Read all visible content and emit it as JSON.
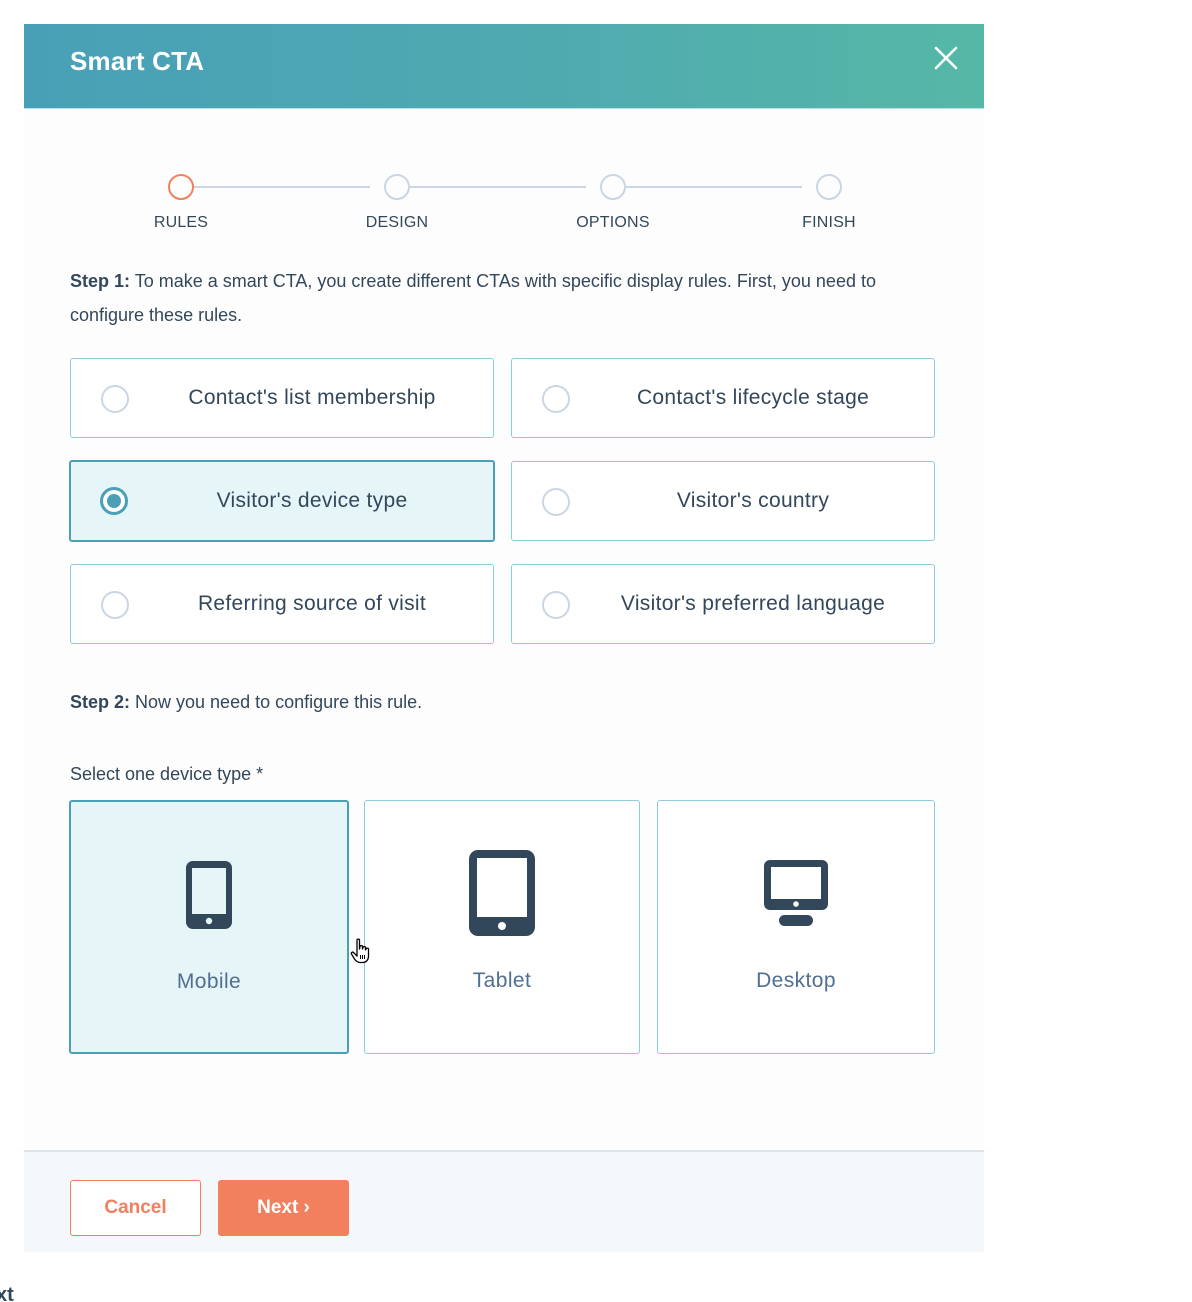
{
  "modal": {
    "title": "Smart CTA",
    "close_icon": "close-icon"
  },
  "stepper": {
    "steps": [
      {
        "label": "RULES",
        "state": "active"
      },
      {
        "label": "DESIGN",
        "state": "pending"
      },
      {
        "label": "OPTIONS",
        "state": "pending"
      },
      {
        "label": "FINISH",
        "state": "pending"
      }
    ]
  },
  "step1": {
    "prefix": "Step 1:",
    "text": " To make a smart CTA, you create different CTAs with specific display rules. First, you need to configure these rules."
  },
  "rules": [
    {
      "label": "Contact's list membership",
      "selected": false
    },
    {
      "label": "Contact's lifecycle stage",
      "selected": false
    },
    {
      "label": "Visitor's device type",
      "selected": true
    },
    {
      "label": "Visitor's country",
      "selected": false
    },
    {
      "label": "Referring source of visit",
      "selected": false
    },
    {
      "label": "Visitor's preferred language",
      "selected": false
    }
  ],
  "step2": {
    "prefix": "Step 2:",
    "text": " Now you need to configure this rule."
  },
  "device_select": {
    "label": "Select one device type *",
    "options": [
      {
        "label": "Mobile",
        "icon": "mobile-phone-icon",
        "selected": true
      },
      {
        "label": "Tablet",
        "icon": "tablet-icon",
        "selected": false
      },
      {
        "label": "Desktop",
        "icon": "desktop-monitor-icon",
        "selected": false
      }
    ]
  },
  "footer": {
    "cancel_label": "Cancel",
    "next_label": "Next ›"
  },
  "stray_text": "xt",
  "colors": {
    "accent": "#f2805f",
    "selected_border": "#4aa0b5",
    "selected_bg": "#e5f5f8",
    "header_start": "#48a0b7",
    "header_end": "#55b8a6",
    "text": "#33475b"
  }
}
